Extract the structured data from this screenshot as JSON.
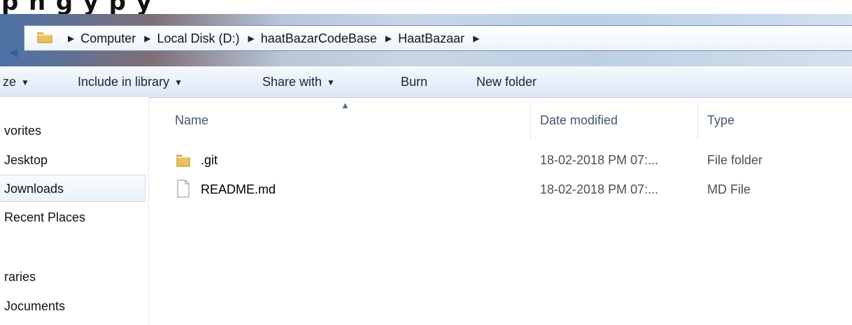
{
  "window": {
    "heading_fragment": "p     n g      y                    p    y"
  },
  "address_bar": {
    "breadcrumbs": [
      "Computer",
      "Local Disk (D:)",
      "haatBazarCodeBase",
      "HaatBazaar"
    ],
    "separator_icon": "triangle-right-icon",
    "nav_icon": "nav-arrow-icon",
    "folder_icon": "folder-icon"
  },
  "toolbar": {
    "organize_label": "ze",
    "include_label": "Include in library",
    "share_label": "Share with",
    "burn_label": "Burn",
    "new_folder_label": "New folder",
    "dropdown_icon": "triangle-down-icon"
  },
  "sidebar": {
    "items": [
      {
        "label": "vorites"
      },
      {
        "label": "Jesktop"
      },
      {
        "label": "Jownloads"
      },
      {
        "label": "Recent Places"
      },
      {
        "label": "raries"
      },
      {
        "label": "Jocuments"
      }
    ]
  },
  "content": {
    "columns": {
      "name": "Name",
      "date_modified": "Date modified",
      "type": "Type"
    },
    "sort_icon": "sort-up-icon",
    "files": [
      {
        "name": ".git",
        "date_modified": "18-02-2018 PM 07:...",
        "type": "File folder",
        "icon": "folder-icon"
      },
      {
        "name": "README.md",
        "date_modified": "18-02-2018 PM 07:...",
        "type": "MD File",
        "icon": "document-icon"
      }
    ]
  },
  "colors": {
    "accent_blue": "#4a72a6",
    "selection_blue": "#eaf2fb",
    "folder_yellow": "#e8c35d"
  }
}
